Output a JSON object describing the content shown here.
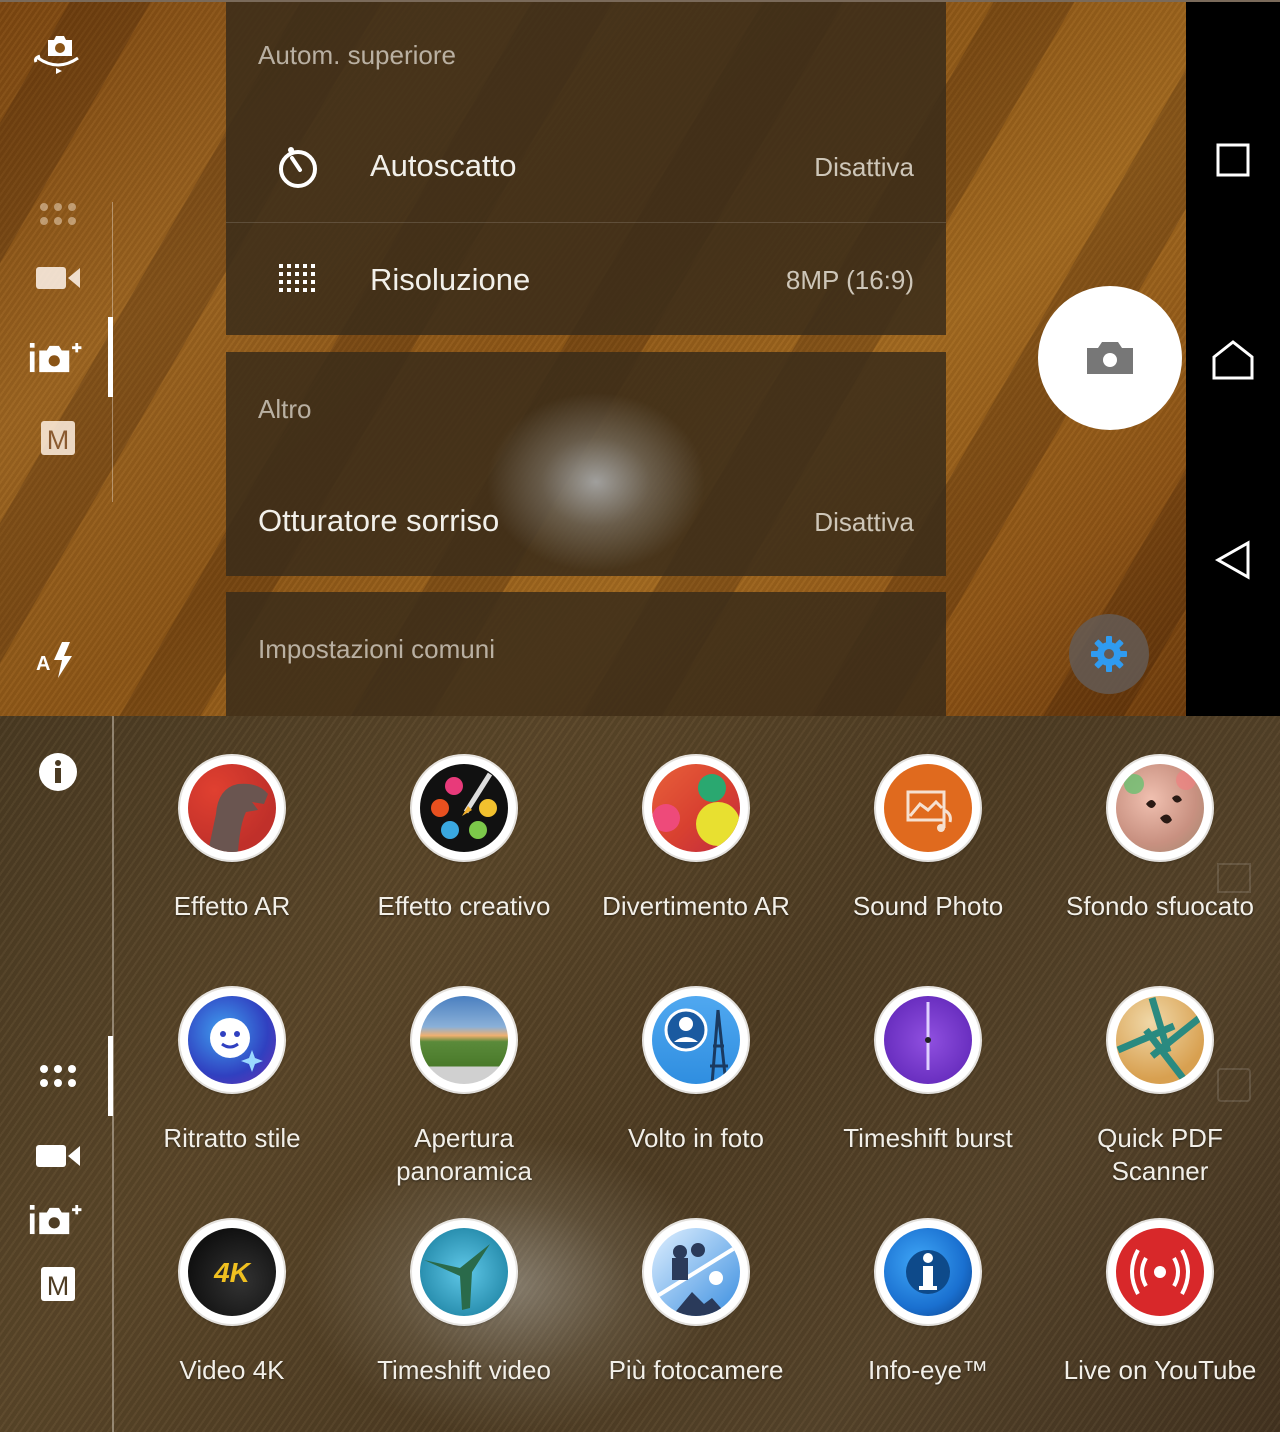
{
  "top_screen": {
    "left_rail": {
      "icons": [
        {
          "name": "switch-camera-icon",
          "label": "Switch camera"
        },
        {
          "name": "app-grid-icon",
          "label": "Camera apps"
        },
        {
          "name": "video-icon",
          "label": "Video"
        },
        {
          "name": "superior-auto-icon",
          "label": "Superior auto"
        },
        {
          "name": "manual-mode-icon",
          "label": "M"
        },
        {
          "name": "flash-auto-icon",
          "label": "A"
        }
      ],
      "active_mode": "superior-auto"
    },
    "settings_panel": {
      "sections": [
        {
          "title": "Autom. superiore",
          "rows": [
            {
              "icon": "self-timer-icon",
              "label": "Autoscatto",
              "value": "Disattiva"
            },
            {
              "icon": "resolution-icon",
              "label": "Risoluzione",
              "value": "8MP (16:9)"
            }
          ]
        },
        {
          "title": "Altro",
          "rows": [
            {
              "label": "Otturatore sorriso",
              "value": "Disattiva"
            }
          ]
        },
        {
          "title": "Impostazioni comuni",
          "rows": []
        }
      ]
    },
    "shutter_button": {
      "icon": "camera-icon",
      "label": "Take photo"
    },
    "settings_button": {
      "icon": "gear-icon",
      "color": "#2f9bf0"
    },
    "nav_bar": {
      "recents": "recents-icon",
      "home": "home-icon",
      "back": "back-icon"
    }
  },
  "bottom_screen": {
    "left_rail": {
      "info": "info-icon",
      "modes": [
        {
          "name": "app-grid-icon",
          "label": "Camera apps"
        },
        {
          "name": "video-icon",
          "label": "Video"
        },
        {
          "name": "superior-auto-icon",
          "label": "Superior auto"
        },
        {
          "name": "manual-mode-icon",
          "label": "M"
        }
      ],
      "active_mode": "app-grid"
    },
    "apps": [
      {
        "label": "Effetto AR",
        "icon": "ar-effect-dinosaur-icon",
        "color": "#c0302a"
      },
      {
        "label": "Effetto creativo",
        "icon": "creative-effect-palette-icon",
        "color": "#111111"
      },
      {
        "label": "Divertimento AR",
        "icon": "ar-fun-balls-icon",
        "color": "#d84030"
      },
      {
        "label": "Sound Photo",
        "icon": "sound-photo-icon",
        "color": "#e06a1e"
      },
      {
        "label": "Sfondo sfuocato",
        "icon": "background-defocus-icon",
        "color": "#c89080"
      },
      {
        "label": "Ritratto stile",
        "icon": "style-portrait-icon",
        "color": "#3040c0"
      },
      {
        "label": "Apertura panoramica",
        "label_lines": [
          "Apertura",
          "panoramica"
        ],
        "icon": "sweep-panorama-icon",
        "color": "#5a8a3a"
      },
      {
        "label": "Volto in foto",
        "icon": "face-in-picture-icon",
        "color": "#2f8ee0"
      },
      {
        "label": "Timeshift burst",
        "icon": "timeshift-burst-icon",
        "color": "#6a2fc0"
      },
      {
        "label": "Quick PDF Scanner",
        "label_lines": [
          "Quick PDF",
          "Scanner"
        ],
        "icon": "pdf-scanner-aperture-icon",
        "color": "#2a8a80"
      },
      {
        "label": "Video 4K",
        "icon": "video-4k-icon",
        "color": "#111111"
      },
      {
        "label": "Timeshift video",
        "icon": "timeshift-video-hummingbird-icon",
        "color": "#2a90b0"
      },
      {
        "label": "Più fotocamere",
        "icon": "multi-camera-icon",
        "color": "#3a8ee0"
      },
      {
        "label": "Info-eye™",
        "icon": "info-eye-icon",
        "color": "#1a70d0"
      },
      {
        "label": "Live on YouTube",
        "icon": "live-broadcast-icon",
        "color": "#d8282a"
      }
    ]
  }
}
